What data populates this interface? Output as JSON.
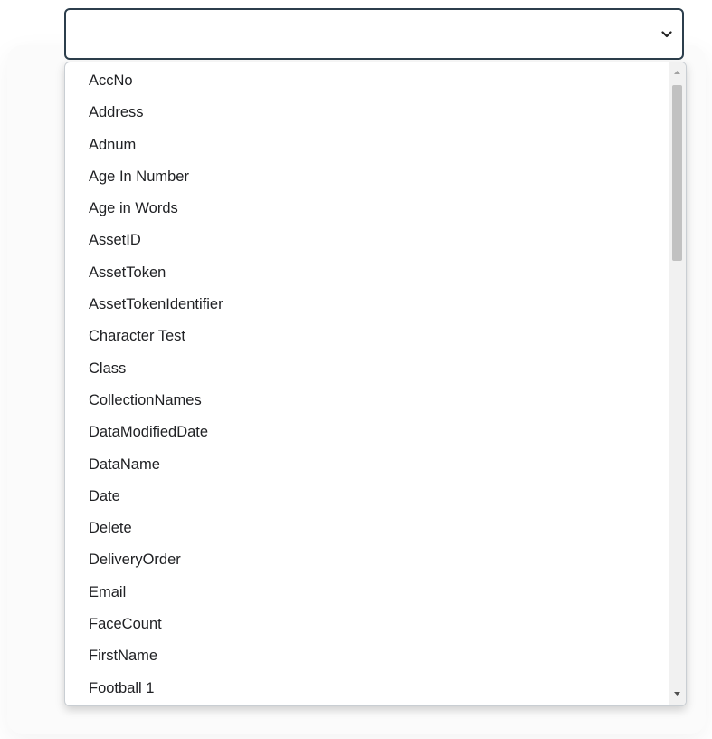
{
  "select": {
    "value": "",
    "icon": "chevron-down-icon",
    "border_color": "#2c3e4c"
  },
  "dropdown": {
    "options": [
      "AccNo",
      "Address",
      "Adnum",
      "Age In Number",
      "Age in Words",
      "AssetID",
      "AssetToken",
      "AssetTokenIdentifier",
      "Character Test",
      "Class",
      "CollectionNames",
      "DataModifiedDate",
      "DataName",
      "Date",
      "Delete",
      "DeliveryOrder",
      "Email",
      "FaceCount",
      "FirstName",
      "Football 1"
    ],
    "scroll_position": 0.0
  }
}
